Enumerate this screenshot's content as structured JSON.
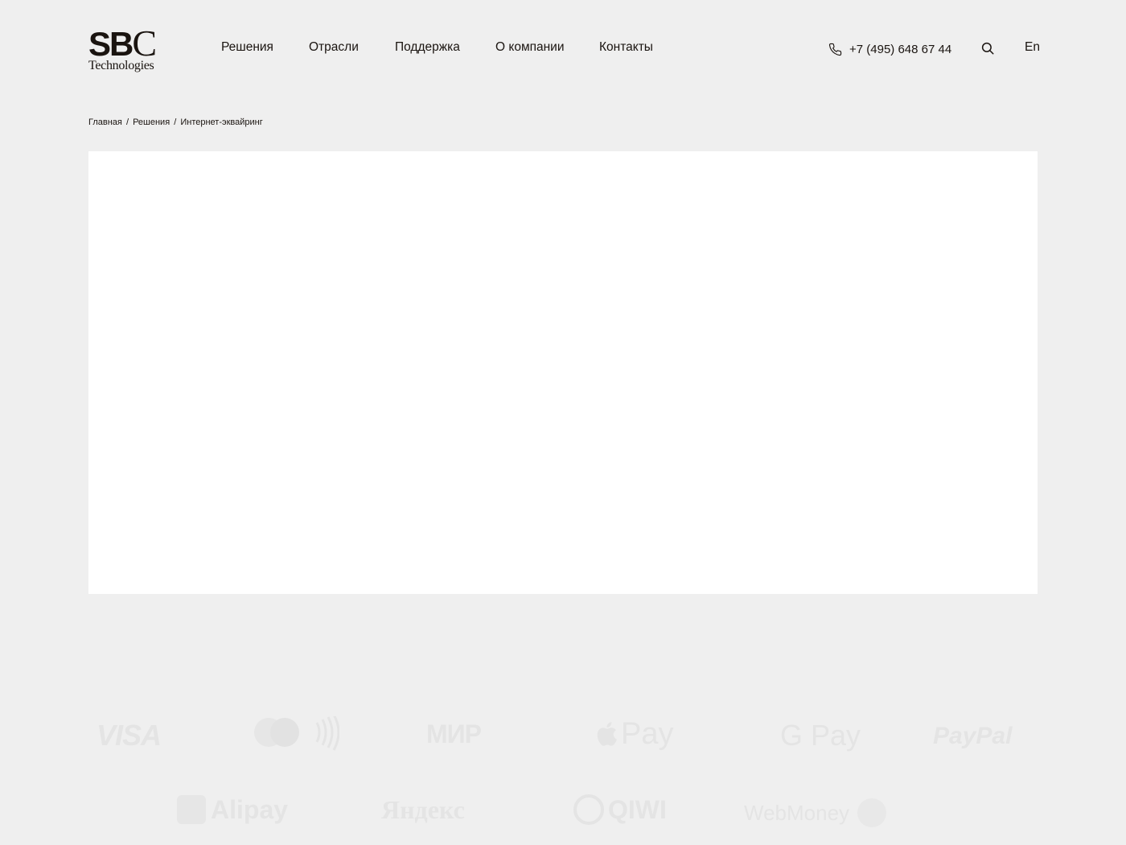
{
  "header": {
    "logo": {
      "mark_sb": "SB",
      "mark_c": "C",
      "subtitle": "Technologies"
    },
    "nav": [
      {
        "label": "Решения"
      },
      {
        "label": "Отрасли"
      },
      {
        "label": "Поддержка"
      },
      {
        "label": "О компании"
      },
      {
        "label": "Контакты"
      }
    ],
    "phone": {
      "number": "+7 (495) 648 67 44",
      "icon": "phone-icon"
    },
    "search": {
      "icon": "search-icon"
    },
    "language": "En"
  },
  "breadcrumb": {
    "items": [
      "Главная",
      "Решения",
      "Интернет-эквайринг"
    ],
    "separator": "/"
  },
  "payment_logos": {
    "row1": [
      "VISA",
      "MasterCard",
      "МИР",
      "Pay",
      "G Pay",
      "PayPal"
    ],
    "row2": [
      "Alipay",
      "Яндекс",
      "QIWI",
      "WebMoney"
    ]
  },
  "colors": {
    "background": "#efefef",
    "text": "#1a1410",
    "panel": "#ffffff",
    "faded_logo": "#e4e4e4"
  }
}
